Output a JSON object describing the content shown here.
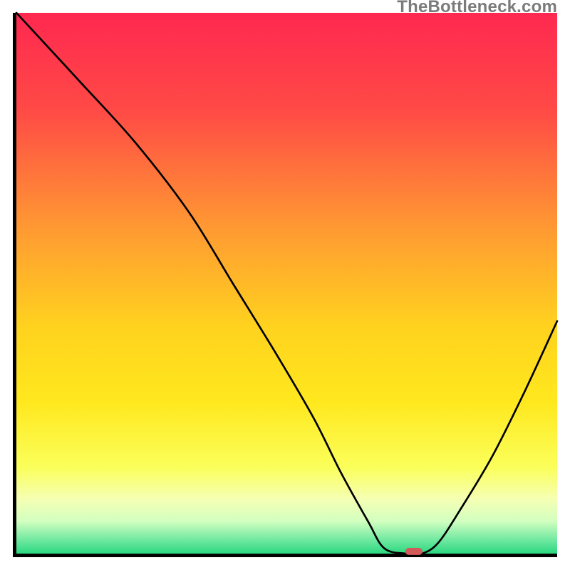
{
  "watermark": "TheBottleneck.com",
  "chart_data": {
    "type": "line",
    "title": "",
    "xlabel": "",
    "ylabel": "",
    "xlim": [
      0,
      100
    ],
    "ylim": [
      0,
      100
    ],
    "grid": false,
    "legend": false,
    "series": [
      {
        "name": "bottleneck-curve",
        "x": [
          0,
          12,
          22,
          32,
          40,
          48,
          55,
          60,
          65,
          68,
          72,
          75,
          78,
          82,
          88,
          94,
          100
        ],
        "y": [
          100,
          87,
          76,
          63,
          50,
          37,
          25,
          15,
          6,
          1,
          0,
          0,
          2,
          8,
          18,
          30,
          43
        ]
      }
    ],
    "marker": {
      "name": "optimal-point",
      "x": 73.5,
      "y": 0,
      "width": 3.2,
      "height": 1.3,
      "color": "#d35a5a"
    },
    "background_gradient": {
      "stops": [
        {
          "offset": 0.0,
          "color": "#ff2850"
        },
        {
          "offset": 0.18,
          "color": "#ff4a46"
        },
        {
          "offset": 0.4,
          "color": "#ff9a32"
        },
        {
          "offset": 0.58,
          "color": "#ffd21e"
        },
        {
          "offset": 0.72,
          "color": "#ffe81e"
        },
        {
          "offset": 0.84,
          "color": "#fbff5a"
        },
        {
          "offset": 0.9,
          "color": "#f5ffb4"
        },
        {
          "offset": 0.94,
          "color": "#d2ffc0"
        },
        {
          "offset": 0.975,
          "color": "#6fe8a0"
        },
        {
          "offset": 1.0,
          "color": "#2bd880"
        }
      ]
    }
  }
}
